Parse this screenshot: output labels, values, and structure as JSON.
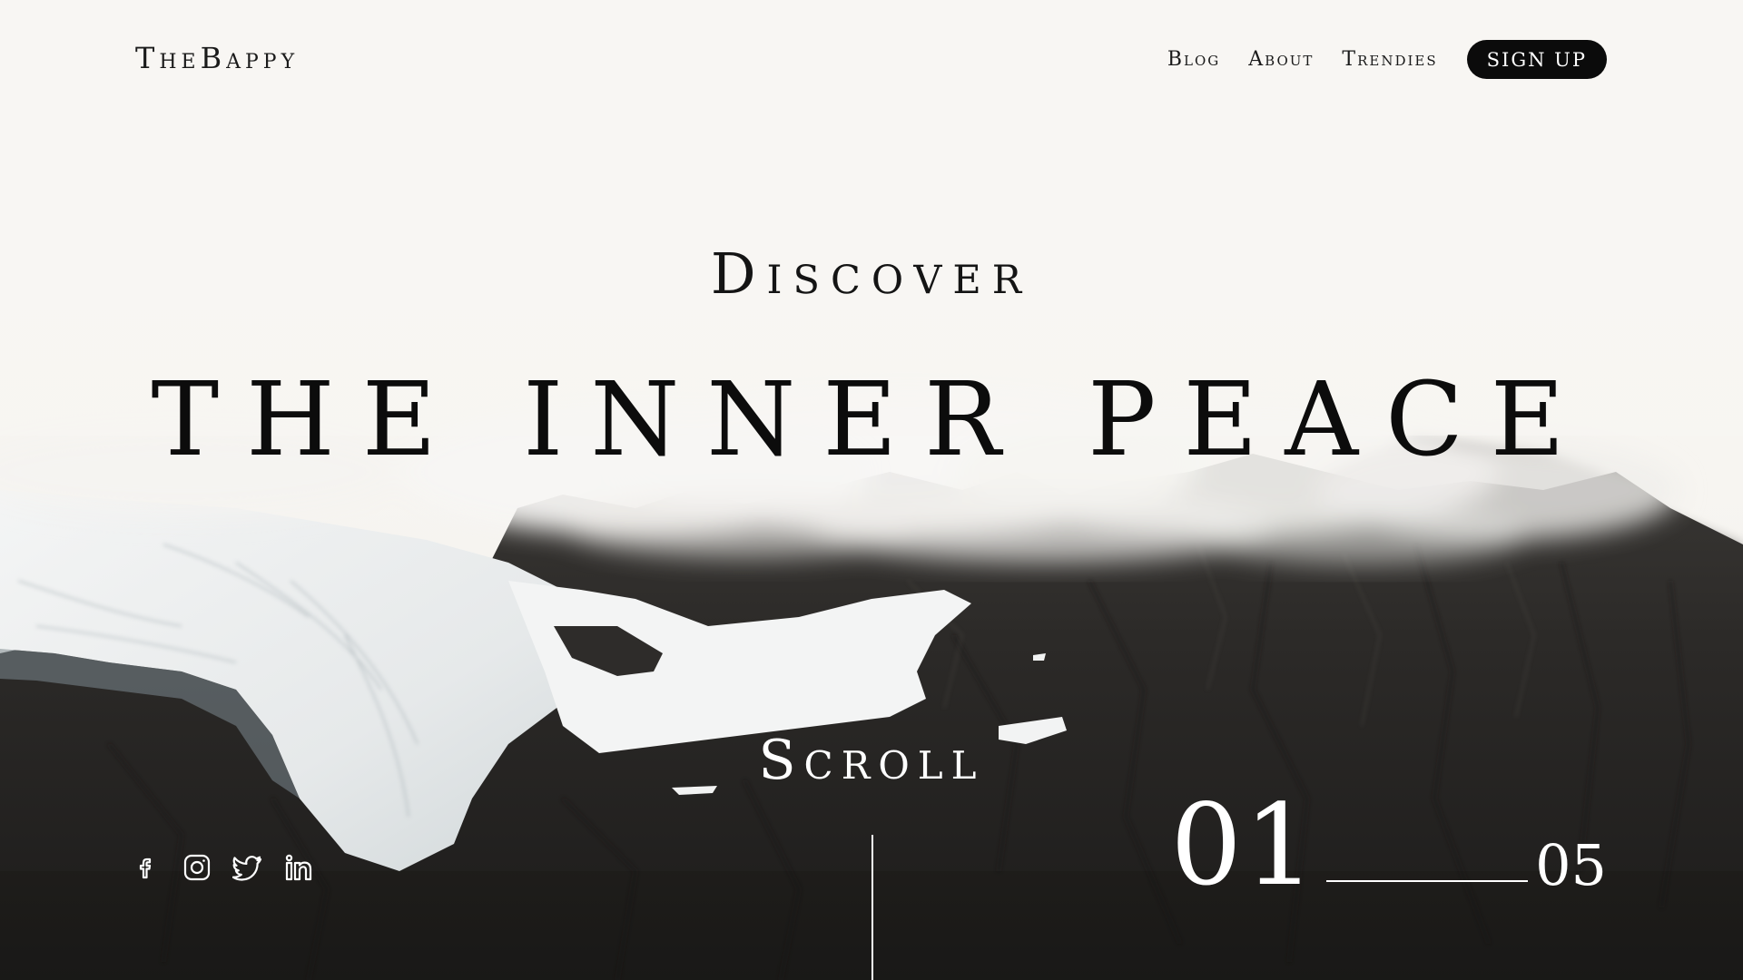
{
  "brand": {
    "name": "TheBappy"
  },
  "nav": {
    "links": [
      "Blog",
      "About",
      "Trendies"
    ],
    "signup_label": "SIGN UP"
  },
  "hero": {
    "kicker": "Discover",
    "title": "THE INNER PEACE",
    "scroll_label": "Scroll"
  },
  "social": {
    "icons": [
      "facebook-icon",
      "instagram-icon",
      "twitter-icon",
      "linkedin-icon"
    ]
  },
  "slider": {
    "current": "01",
    "total": "05"
  },
  "colors": {
    "sky": "#f8f6f2",
    "rock": "#2b2927",
    "snow": "#eef0f0",
    "button": "#0b0b0b",
    "text_dark": "#111111",
    "text_light": "#ffffff"
  }
}
